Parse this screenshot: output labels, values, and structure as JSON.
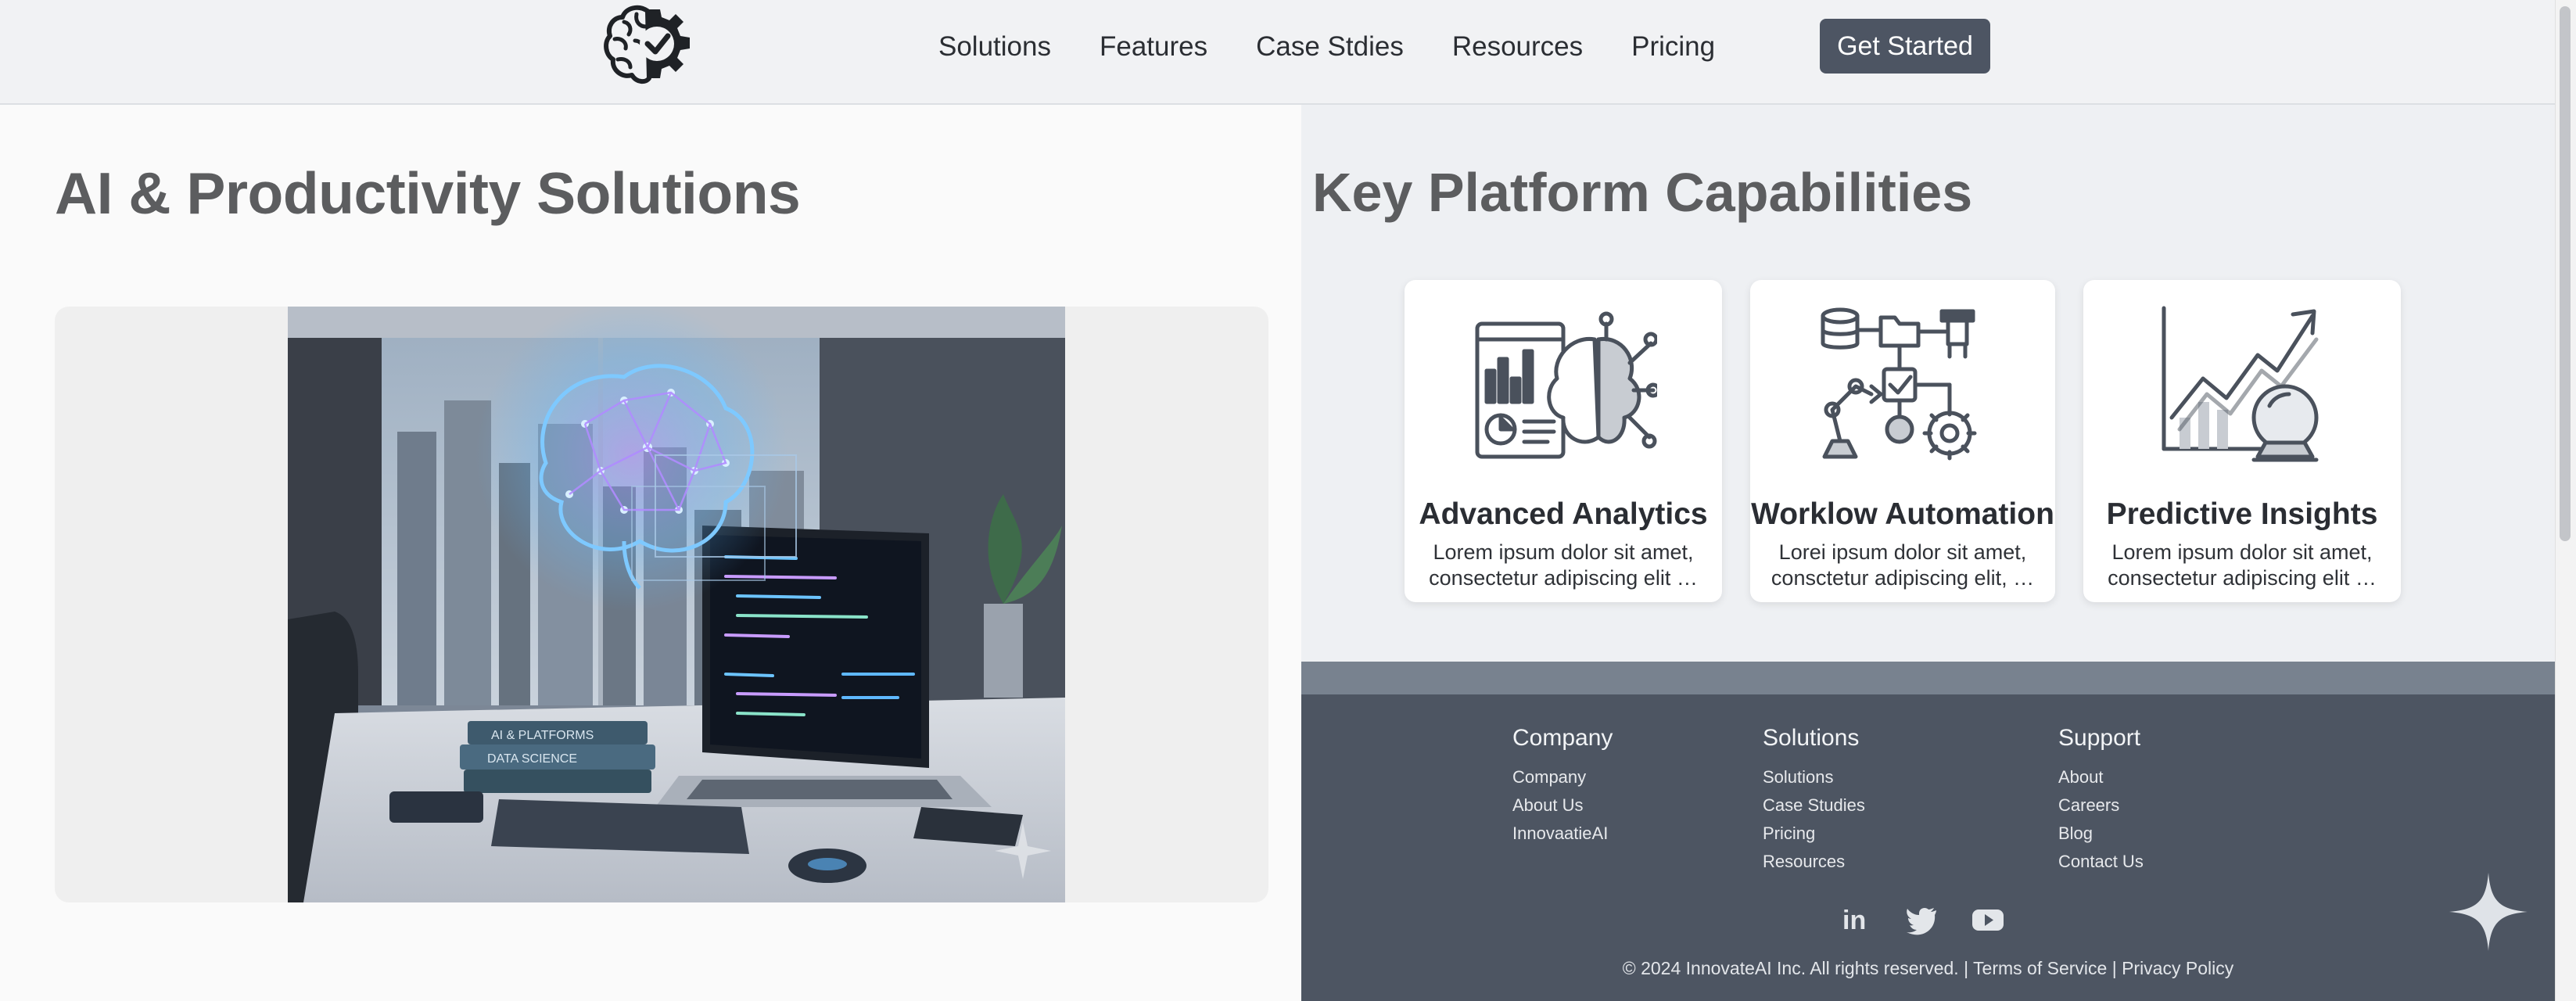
{
  "nav": {
    "logo_icon": "brain-gear-check-icon",
    "links": [
      "Solutions",
      "Features",
      "Case Stdies",
      "Resources",
      "Pricing"
    ],
    "cta": "Get Started"
  },
  "left": {
    "title": "AI & Productivity Solutions",
    "hero_book_labels": [
      "AI & PLATFORMS",
      "DATA SCIENCE"
    ]
  },
  "right": {
    "title": "Key Platform Capabilities",
    "cards": [
      {
        "title": "Advanced Analytics",
        "desc": "Lorem ipsum dolor sit amet, consectetur adipiscing elit …",
        "icon": "analytics-brain-icon"
      },
      {
        "title": "Worklow Automation",
        "desc": "Lorei ipsum dolor sit amet, consctetur adipiscing elit, …",
        "icon": "workflow-robot-icon"
      },
      {
        "title": "Predictive Insights",
        "desc": "Lorem ipsum dolor sit amet, consectetur adipiscing elit …",
        "icon": "trend-crystal-ball-icon"
      }
    ]
  },
  "footer": {
    "columns": [
      {
        "heading": "Company",
        "links": [
          "Company",
          "About Us",
          "InnovaatieAI"
        ]
      },
      {
        "heading": "Solutions",
        "links": [
          "Solutions",
          "Case Studies",
          "Pricing",
          "Resources"
        ]
      },
      {
        "heading": "Support",
        "links": [
          "About",
          "Careers",
          "Blog",
          "Contact Us"
        ]
      }
    ],
    "social_icons": [
      "linkedin-icon",
      "twitter-icon",
      "youtube-icon"
    ],
    "social_labels": [
      "in"
    ],
    "copyright": "© 2024 InnovateAI Inc. All rights reserved.",
    "separator": "|",
    "terms": "Terms of Service",
    "privacy": "Privacy Policy"
  },
  "colors": {
    "nav_bg": "#f1f2f4",
    "cta_bg": "#4d5563",
    "footer_bg": "#4d5562",
    "footer_band": "#78828f",
    "heading_gray": "#5c5d5f",
    "brain_glow": "#5fb8ff"
  }
}
